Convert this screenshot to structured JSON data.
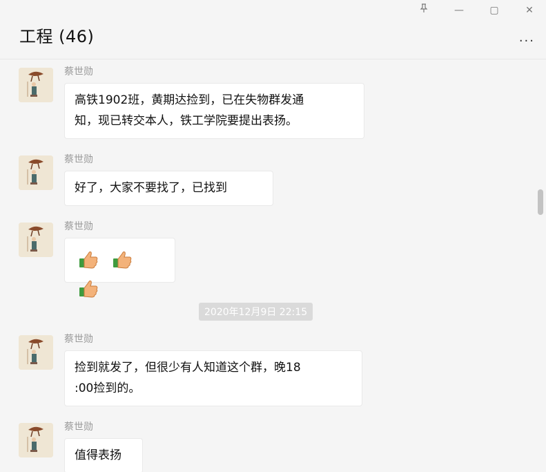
{
  "window": {
    "title": "工程 (46)",
    "pin_icon": "pin-icon",
    "minimize_label": "—",
    "maximize_label": "▢",
    "close_label": "✕",
    "more_label": "..."
  },
  "messages": [
    {
      "sender": "蔡世勋",
      "lines": [
        "高铁1902班，黄期达捡到，已在失物群发通",
        "知，现已转交本人，铁工学院要提出表扬。"
      ]
    },
    {
      "sender": "蔡世勋",
      "lines": [
        "好了，大家不要找了，已找到"
      ]
    },
    {
      "sender": "蔡世勋",
      "emoji": [
        "thumbs-up-icon",
        "thumbs-up-icon",
        "thumbs-up-icon"
      ]
    },
    {
      "sender": "蔡世勋",
      "lines": [
        "捡到就发了，但很少有人知道这个群，晚18",
        ":00捡到的。"
      ]
    },
    {
      "sender": "蔡世勋",
      "lines": [
        "值得表扬"
      ]
    }
  ],
  "timestamp": "2020年12月9日 22:15"
}
